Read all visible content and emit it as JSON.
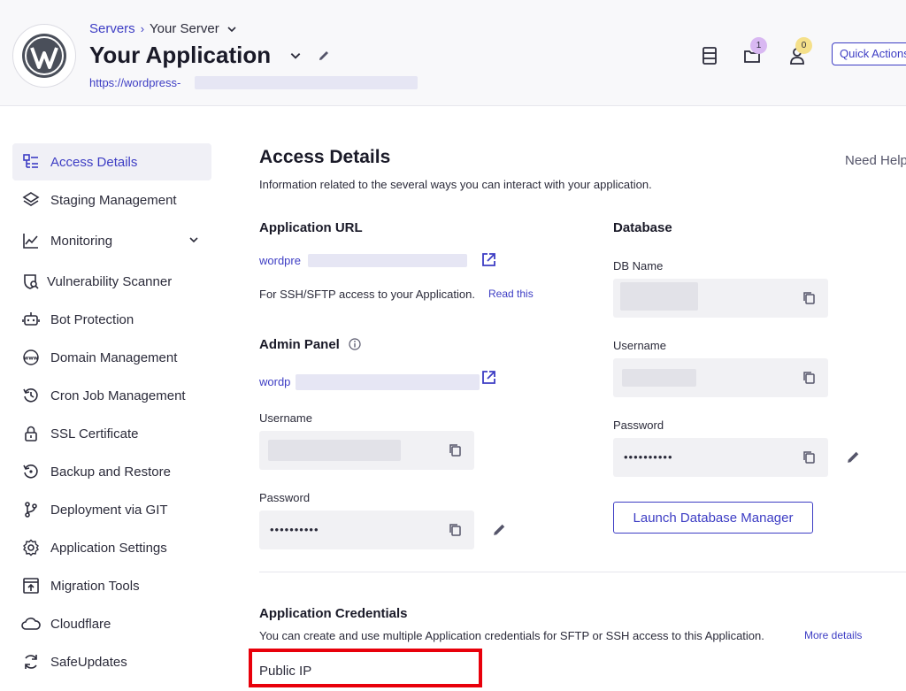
{
  "header": {
    "breadcrumb": {
      "servers": "Servers",
      "separator": "›",
      "server": "Your Server"
    },
    "title": "Your Application",
    "url": "https://wordpress-",
    "icons": [
      "server-list-icon",
      "folder-icon",
      "user-icon"
    ],
    "folder_badge": "1",
    "user_badge": "0",
    "quick_actions_label": "Quick Actions"
  },
  "sidebar": {
    "items": [
      {
        "label": "Access Details",
        "icon": "access-details-icon",
        "active": true
      },
      {
        "label": "Staging Management",
        "icon": "layers-icon"
      },
      {
        "label": "Monitoring",
        "icon": "chart-icon",
        "expandable": true
      },
      {
        "label": "Vulnerability Scanner",
        "icon": "shield-scan-icon"
      },
      {
        "label": "Bot Protection",
        "icon": "robot-icon"
      },
      {
        "label": "Domain Management",
        "icon": "www-icon"
      },
      {
        "label": "Cron Job Management",
        "icon": "history-icon"
      },
      {
        "label": "SSL Certificate",
        "icon": "lock-icon"
      },
      {
        "label": "Backup and Restore",
        "icon": "backup-icon"
      },
      {
        "label": "Deployment via GIT",
        "icon": "git-icon"
      },
      {
        "label": "Application Settings",
        "icon": "gear-icon"
      },
      {
        "label": "Migration Tools",
        "icon": "migration-icon"
      },
      {
        "label": "Cloudflare",
        "icon": "cloud-icon"
      },
      {
        "label": "SafeUpdates",
        "icon": "refresh-icon"
      }
    ]
  },
  "main": {
    "title": "Access Details",
    "need_help": "Need Help?",
    "subtitle": "Information related to the several ways you can interact with your application.",
    "application_url": {
      "title": "Application URL",
      "link": "wordpre",
      "ssh_note": "For SSH/SFTP access to your Application.",
      "read_this": "Read this"
    },
    "admin_panel": {
      "title": "Admin Panel",
      "link": "wordp",
      "username_label": "Username",
      "password_label": "Password",
      "password_value": "••••••••••"
    },
    "database": {
      "title": "Database",
      "db_name_label": "DB Name",
      "username_label": "Username",
      "password_label": "Password",
      "password_value": "••••••••••",
      "launch_button": "Launch Database Manager"
    },
    "credentials": {
      "title": "Application Credentials",
      "description": "You can create and use multiple Application credentials for SFTP or SSH access to this Application.",
      "more_details": "More details",
      "public_ip_label": "Public IP"
    }
  },
  "colors": {
    "accent": "#3d3dc4",
    "highlight_box": "#e8000b"
  }
}
